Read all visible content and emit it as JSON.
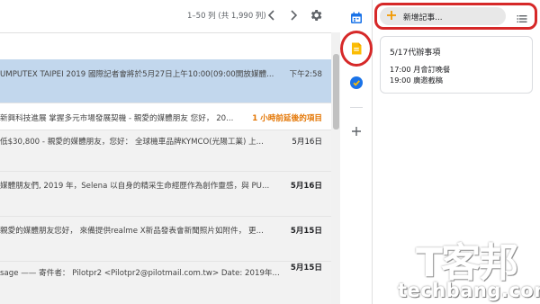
{
  "mail": {
    "pager": "1–50 列 (共 1,990 列)",
    "rows": [
      {
        "snippet": "UMPUTEX TAIPEI 2019 國際記者會將於5月27日上午10:00(09:00開放媒體...",
        "date": "下午2:58"
      },
      {
        "snippet": "新興科技進展 掌握多元市場發展契機 - 親愛的媒體朋友 您好， 20...",
        "date": "1 小時前延後的項目"
      },
      {
        "snippet": "低$30,800 - 親愛的媒體朋友，您好： 全球機車品牌KYMCO(光陽工業) 上...",
        "date": "5月16日"
      },
      {
        "snippet": "媒體朋友們, 2019 年，Selena 以自身的精采生命經歷作為創作靈感，與 PU...",
        "date": "5月16日"
      },
      {
        "snippet": "親愛的媒體朋友您好， 來備提供realme X新品發表會新聞照片如附件， 更...",
        "date": "5月15日"
      },
      {
        "snippet": "sage —— 寄件者： Pilotpr2 <Pilotpr2@pilotmail.com.tw> Date: 2019年...",
        "date": "5月15日"
      }
    ]
  },
  "side_panel": {
    "icons": [
      "calendar-icon",
      "keep-icon",
      "tasks-icon",
      "add-addon-icon"
    ]
  },
  "keep": {
    "new_note_label": "新增記事...",
    "note": {
      "title": "5/17代辦事項",
      "lines": [
        "17:00 月會訂晚餐",
        "19:00 廣邀截稿"
      ]
    }
  },
  "watermark": {
    "logo": "T客邦",
    "domain": "techbang.com"
  },
  "colors": {
    "highlight_red": "#d62828",
    "selected_row": "#c2d7ed",
    "snoozed_orange": "#e37400",
    "keep_yellow": "#fbbc04",
    "tasks_blue": "#1a73e8"
  }
}
